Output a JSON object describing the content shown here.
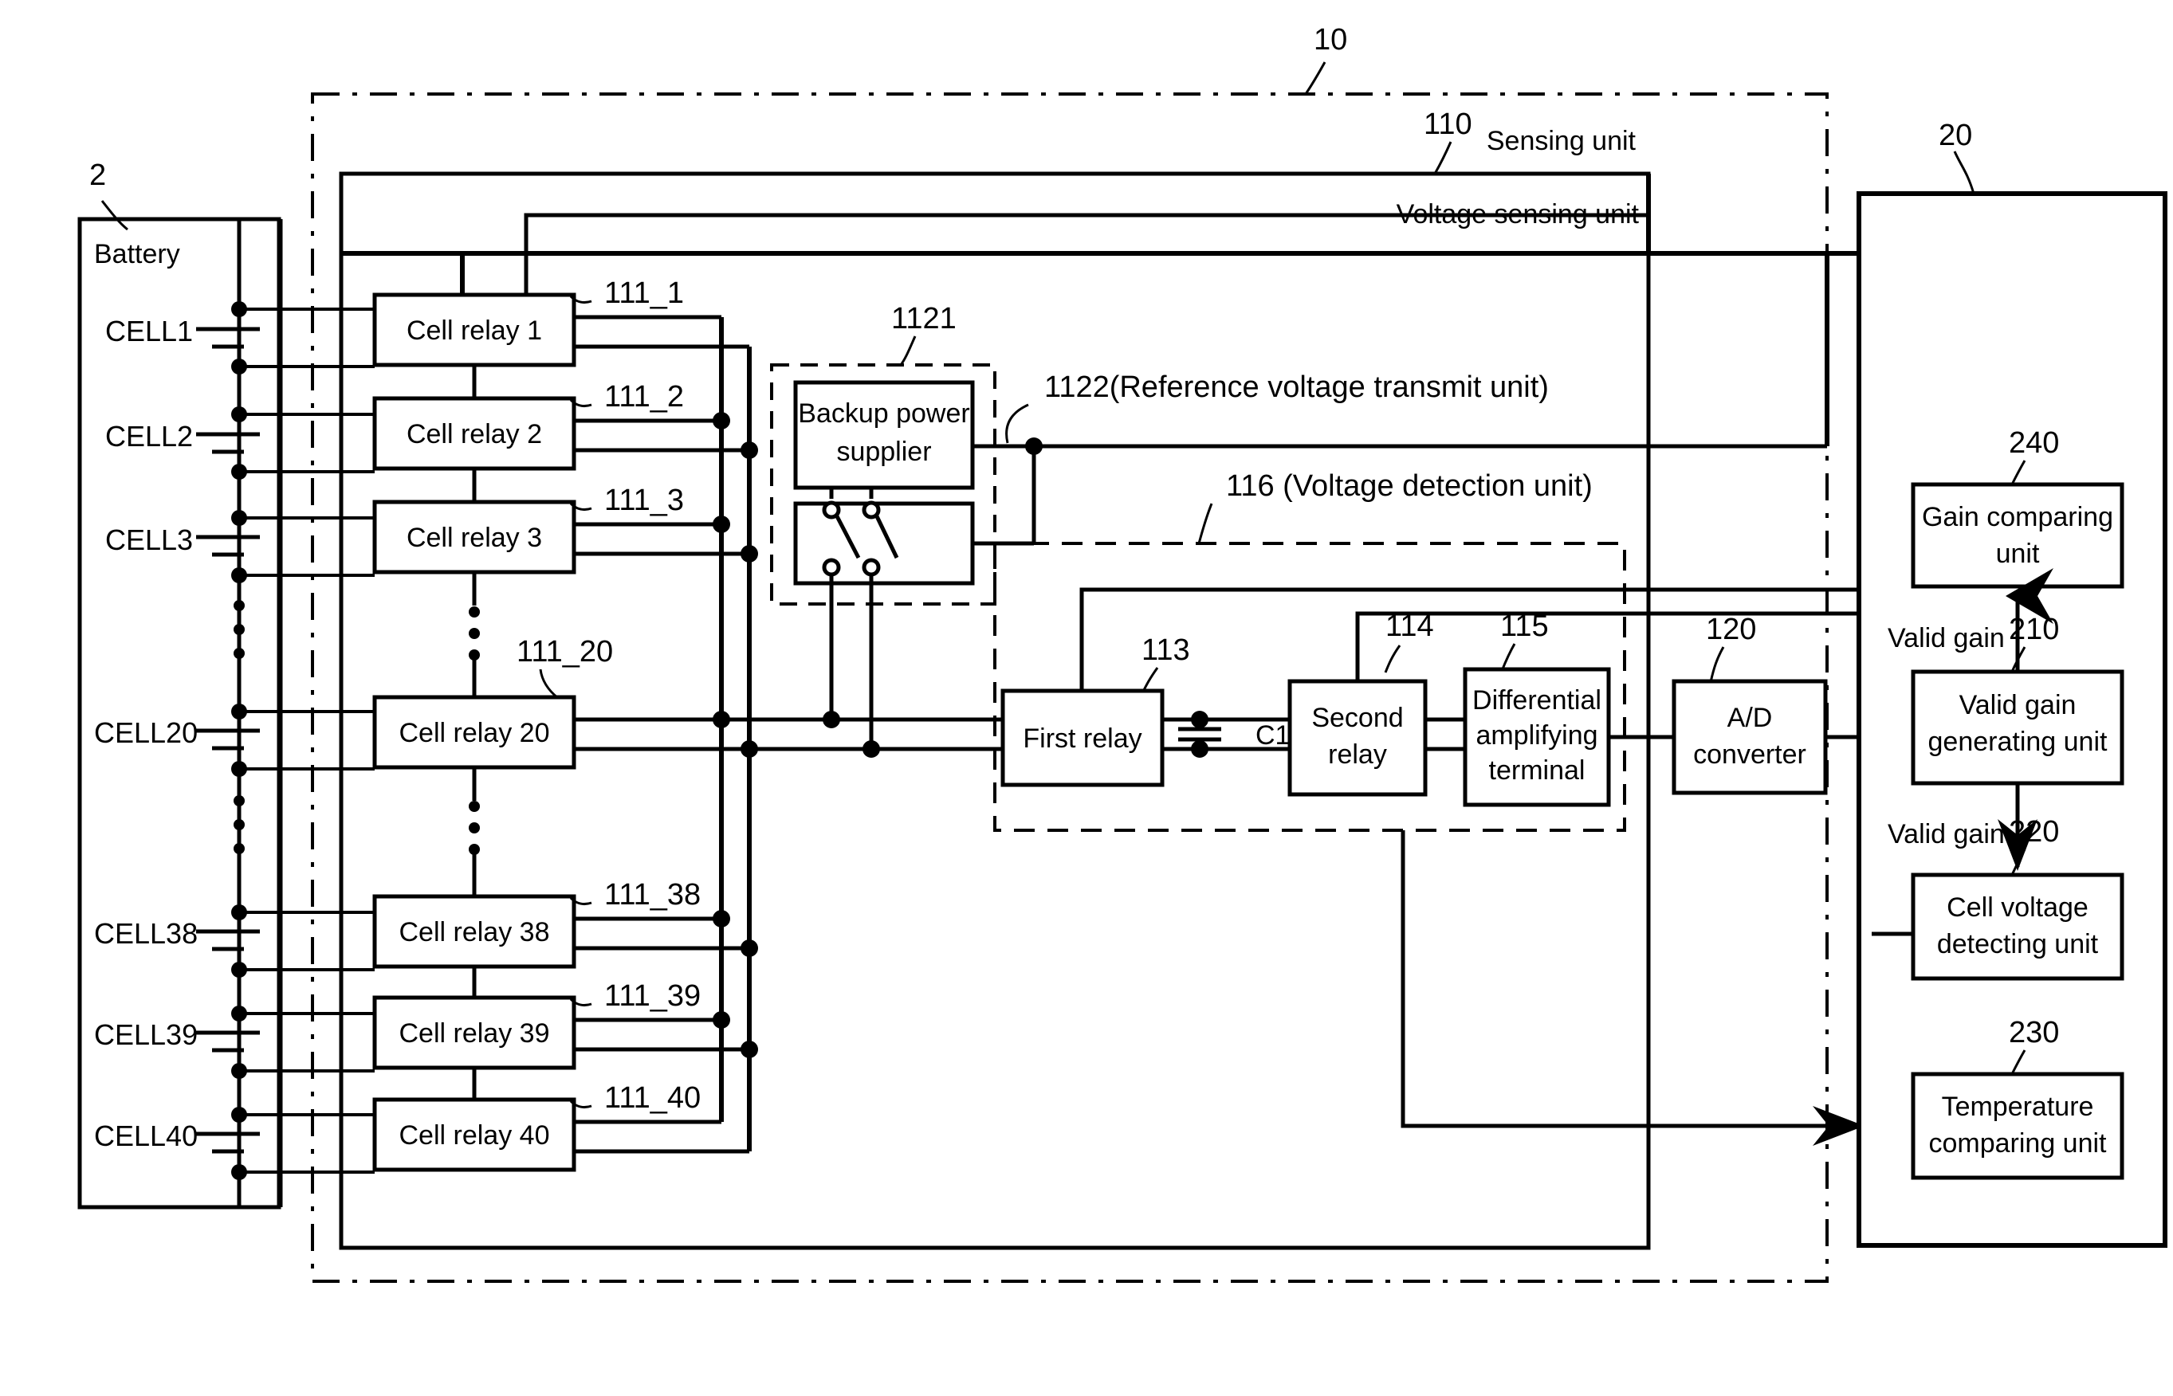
{
  "figure": {
    "type": "patent-block-diagram",
    "domain": "battery management system sensing circuit"
  },
  "reference_numerals": {
    "battery": "2",
    "sensing_system": "10",
    "control_unit": "20",
    "voltage_sensing_unit": "110",
    "ad_converter": "120",
    "cell_relay_1": "111_1",
    "cell_relay_2": "111_2",
    "cell_relay_3": "111_3",
    "cell_relay_20": "111_20",
    "cell_relay_38": "111_38",
    "cell_relay_39": "111_39",
    "cell_relay_40": "111_40",
    "backup_power_block": "1121",
    "reference_voltage_transmit_unit": "1122(Reference voltage transmit unit)",
    "voltage_detection_unit": "116 (Voltage detection unit)",
    "first_relay": "113",
    "second_relay": "114",
    "differential_amplifying_terminal": "115",
    "valid_gain_generating_unit": "210",
    "cell_voltage_detecting_unit": "220",
    "temperature_comparing_unit": "230",
    "gain_comparing_unit": "240"
  },
  "frame_labels": {
    "sensing_unit": "Sensing unit",
    "voltage_sensing_unit": "Voltage sensing unit"
  },
  "battery": {
    "title": "Battery",
    "cells": [
      {
        "label": "CELL1"
      },
      {
        "label": "CELL2"
      },
      {
        "label": "CELL3"
      },
      {
        "label": "CELL20"
      },
      {
        "label": "CELL38"
      },
      {
        "label": "CELL39"
      },
      {
        "label": "CELL40"
      }
    ],
    "ellipsis": "⋮"
  },
  "cell_relays": [
    {
      "label": "Cell relay 1",
      "ref": "111_1"
    },
    {
      "label": "Cell relay 2",
      "ref": "111_2"
    },
    {
      "label": "Cell relay 3",
      "ref": "111_3"
    },
    {
      "label": "Cell relay 20",
      "ref": "111_20"
    },
    {
      "label": "Cell relay 38",
      "ref": "111_38"
    },
    {
      "label": "Cell relay 39",
      "ref": "111_39"
    },
    {
      "label": "Cell relay 40",
      "ref": "111_40"
    }
  ],
  "blocks": {
    "backup_power_supplier_line1": "Backup power",
    "backup_power_supplier_line2": "supplier",
    "first_relay": "First relay",
    "capacitor": "C1",
    "second_relay_line1": "Second",
    "second_relay_line2": "relay",
    "diff_amp_line1": "Differential",
    "diff_amp_line2": "amplifying",
    "diff_amp_line3": "terminal",
    "ad_converter_line1": "A/D",
    "ad_converter_line2": "converter",
    "gain_comparing_line1": "Gain comparing",
    "gain_comparing_line2": "unit",
    "valid_gain_gen_line1": "Valid gain",
    "valid_gain_gen_line2": "generating unit",
    "cell_voltage_det_line1": "Cell voltage",
    "cell_voltage_det_line2": "detecting unit",
    "temp_comparing_line1": "Temperature",
    "temp_comparing_line2": "comparing unit"
  },
  "signal_labels": {
    "valid_gain_up": "Valid gain",
    "valid_gain_down": "Valid gain"
  }
}
